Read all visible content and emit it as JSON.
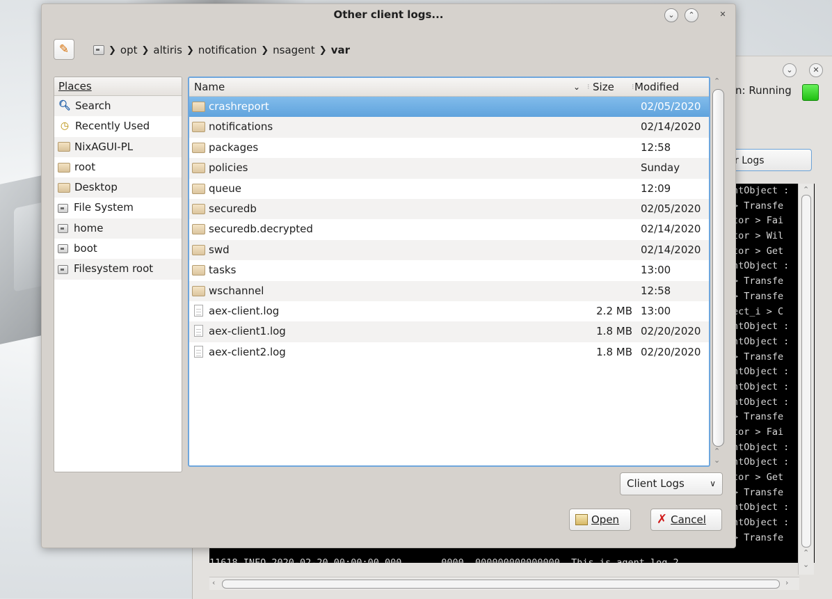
{
  "dialog": {
    "title": "Other client logs...",
    "breadcrumb": [
      "opt",
      "altiris",
      "notification",
      "nsagent",
      "var"
    ],
    "places_header": "Places",
    "places": [
      {
        "label": "Search",
        "icon": "search-icon"
      },
      {
        "label": "Recently Used",
        "icon": "clock-icon"
      },
      {
        "label": "NixAGUI-PL",
        "icon": "folder-icon"
      },
      {
        "label": "root",
        "icon": "home-folder-icon"
      },
      {
        "label": "Desktop",
        "icon": "desktop-folder-icon"
      },
      {
        "label": "File System",
        "icon": "drive-icon"
      },
      {
        "label": "home",
        "icon": "drive-icon"
      },
      {
        "label": "boot",
        "icon": "drive-icon"
      },
      {
        "label": "Filesystem root",
        "icon": "drive-icon"
      }
    ],
    "columns": {
      "name": "Name",
      "size": "Size",
      "modified": "Modified"
    },
    "files": [
      {
        "name": "crashreport",
        "type": "folder",
        "size": "",
        "modified": "02/05/2020",
        "selected": true
      },
      {
        "name": "notifications",
        "type": "folder",
        "size": "",
        "modified": "02/14/2020"
      },
      {
        "name": "packages",
        "type": "folder",
        "size": "",
        "modified": "12:58"
      },
      {
        "name": "policies",
        "type": "folder",
        "size": "",
        "modified": "Sunday"
      },
      {
        "name": "queue",
        "type": "folder",
        "size": "",
        "modified": "12:09"
      },
      {
        "name": "securedb",
        "type": "folder",
        "size": "",
        "modified": "02/05/2020"
      },
      {
        "name": "securedb.decrypted",
        "type": "folder",
        "size": "",
        "modified": "02/14/2020"
      },
      {
        "name": "swd",
        "type": "folder",
        "size": "",
        "modified": "02/14/2020"
      },
      {
        "name": "tasks",
        "type": "folder",
        "size": "",
        "modified": "13:00"
      },
      {
        "name": "wschannel",
        "type": "folder",
        "size": "",
        "modified": "12:58"
      },
      {
        "name": "aex-client.log",
        "type": "file",
        "size": "2.2 MB",
        "modified": "13:00"
      },
      {
        "name": "aex-client1.log",
        "type": "file",
        "size": "1.8 MB",
        "modified": "02/20/2020"
      },
      {
        "name": "aex-client2.log",
        "type": "file",
        "size": "1.8 MB",
        "modified": "02/20/2020"
      }
    ],
    "filter_value": "Client Logs",
    "open_label": "Open",
    "cancel_label": "Cancel"
  },
  "main_window": {
    "status_text": "n: Running",
    "status_color": "#2ecc1a",
    "logs_button_label": "r Logs",
    "terminal_right_lines": [
      "ntObject :",
      "> Transfe",
      "tor > Fai",
      "tor > Wil",
      "tor > Get",
      "ntObject :",
      "> Transfe",
      "> Transfe",
      "ect_i > C",
      "ntObject :",
      "ntObject :",
      "> Transfe",
      "ntObject :",
      "ntObject :",
      "ntObject :",
      "> Transfe",
      "tor > Fai",
      "ntObject :",
      "ntObject :",
      "tor > Get",
      "> Transfe",
      "ntObject :",
      "ntObject :",
      "> Transfe"
    ],
    "terminal_last_line": "11618 INFO 2020-02-20 00:00:00.000       0000  000000000000000  This is agent log 2."
  }
}
